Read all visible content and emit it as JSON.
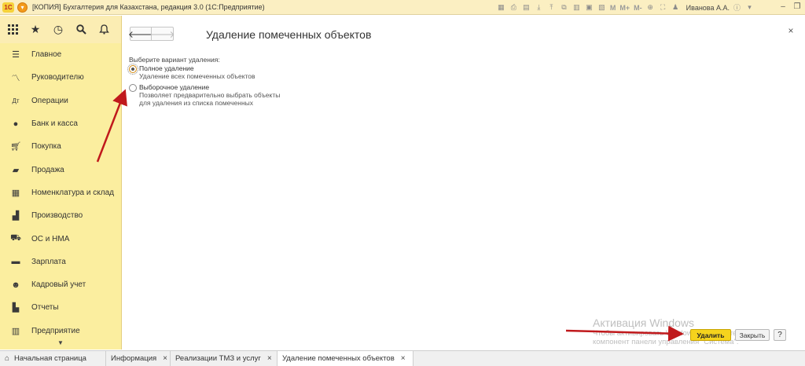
{
  "window": {
    "logo_text": "1С",
    "title": "[КОПИЯ] Бухгалтерия для Казахстана, редакция 3.0  (1С:Предприятие)",
    "user": "Иванова А.А.",
    "toolbar_letters": [
      "M",
      "M+",
      "M-"
    ]
  },
  "sidebar": {
    "items": [
      {
        "label": "Главное",
        "icon": "menu-lines-icon"
      },
      {
        "label": "Руководителю",
        "icon": "trend-chart-icon"
      },
      {
        "label": "Операции",
        "icon": "operations-icon"
      },
      {
        "label": "Банк и касса",
        "icon": "coins-icon"
      },
      {
        "label": "Покупка",
        "icon": "cart-icon"
      },
      {
        "label": "Продажа",
        "icon": "bag-icon"
      },
      {
        "label": "Номенклатура и склад",
        "icon": "warehouse-icon"
      },
      {
        "label": "Производство",
        "icon": "factory-icon"
      },
      {
        "label": "ОС и НМА",
        "icon": "truck-icon"
      },
      {
        "label": "Зарплата",
        "icon": "money-icon"
      },
      {
        "label": "Кадровый учет",
        "icon": "people-icon"
      },
      {
        "label": "Отчеты",
        "icon": "bar-chart-icon"
      },
      {
        "label": "Предприятие",
        "icon": "building-icon"
      }
    ]
  },
  "form": {
    "title": "Удаление помеченных объектов",
    "choose_label": "Выберите вариант удаления:",
    "options": [
      {
        "title": "Полное удаление",
        "desc": [
          "Удаление всех помеченных объектов"
        ],
        "checked": true
      },
      {
        "title": "Выборочное удаление",
        "desc": [
          "Позволяет предварительно выбрать объекты",
          "для удаления из списка помеченных"
        ],
        "checked": false
      }
    ],
    "delete_button": "Удалить",
    "close_button": "Закрыть",
    "help_button": "?"
  },
  "watermark": {
    "title": "Активация Windows",
    "line1": "Чтобы активировать Windows, перейдите в",
    "line2": "компонент панели управления \"Система\"."
  },
  "tabs": [
    {
      "label": "Начальная страница",
      "closable": false,
      "active": false
    },
    {
      "label": "Информация",
      "closable": true,
      "active": false
    },
    {
      "label": "Реализации ТМЗ и услуг",
      "closable": true,
      "active": false
    },
    {
      "label": "Удаление помеченных объектов",
      "closable": true,
      "active": true
    }
  ],
  "colors": {
    "sidebar_bg": "#fbee9f",
    "accent_yellow": "#f5d31d",
    "annotation_red": "#c0191c"
  }
}
